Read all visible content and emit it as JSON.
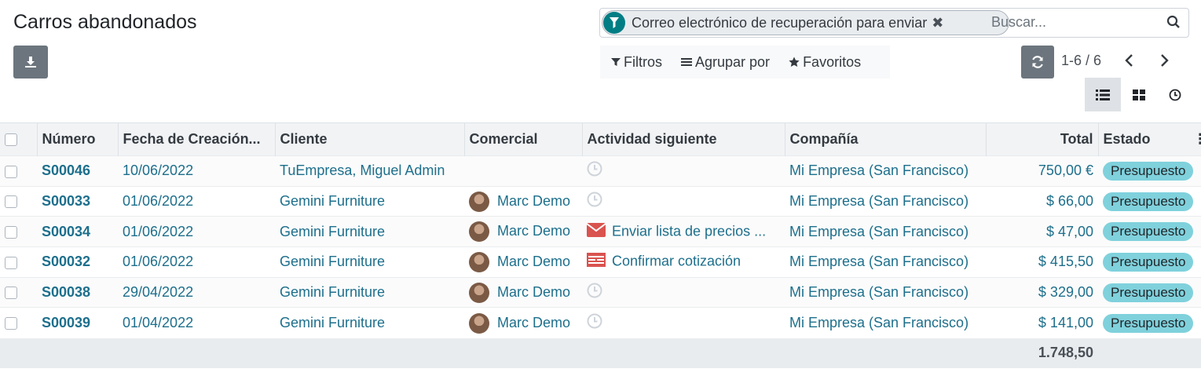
{
  "page": {
    "title": "Carros abandonados"
  },
  "search": {
    "facet_label": "Correo electrónico de recuperación para enviar",
    "facet_close": "✖",
    "placeholder": "Buscar..."
  },
  "filters": {
    "filters_label": "Filtros",
    "group_label": "Agrupar por",
    "favorites_label": "Favoritos"
  },
  "pager": {
    "value": "1-6 / 6"
  },
  "table": {
    "columns": [
      "Número",
      "Fecha de Creación...",
      "Cliente",
      "Comercial",
      "Actividad siguiente",
      "Compañía",
      "Total",
      "Estado"
    ],
    "rows": [
      {
        "number": "S00046",
        "date": "10/06/2022",
        "customer": "TuEmpresa, Miguel Admin",
        "salesperson": "",
        "activity": "",
        "activity_icon": "clock-icon",
        "company": "Mi Empresa (San Francisco)",
        "total": "750,00 €",
        "status": "Presupuesto"
      },
      {
        "number": "S00033",
        "date": "01/06/2022",
        "customer": "Gemini Furniture",
        "salesperson": "Marc Demo",
        "activity": "",
        "activity_icon": "clock-icon",
        "company": "Mi Empresa (San Francisco)",
        "total": "$ 66,00",
        "status": "Presupuesto"
      },
      {
        "number": "S00034",
        "date": "01/06/2022",
        "customer": "Gemini Furniture",
        "salesperson": "Marc Demo",
        "activity": "Enviar lista de precios ...",
        "activity_icon": "envelope-icon",
        "company": "Mi Empresa (San Francisco)",
        "total": "$ 47,00",
        "status": "Presupuesto"
      },
      {
        "number": "S00032",
        "date": "01/06/2022",
        "customer": "Gemini Furniture",
        "salesperson": "Marc Demo",
        "activity": "Confirmar cotización",
        "activity_icon": "document-icon",
        "company": "Mi Empresa (San Francisco)",
        "total": "$ 415,50",
        "status": "Presupuesto"
      },
      {
        "number": "S00038",
        "date": "29/04/2022",
        "customer": "Gemini Furniture",
        "salesperson": "Marc Demo",
        "activity": "",
        "activity_icon": "clock-icon",
        "company": "Mi Empresa (San Francisco)",
        "total": "$ 329,00",
        "status": "Presupuesto"
      },
      {
        "number": "S00039",
        "date": "01/04/2022",
        "customer": "Gemini Furniture",
        "salesperson": "Marc Demo",
        "activity": "",
        "activity_icon": "clock-icon",
        "company": "Mi Empresa (San Francisco)",
        "total": "$ 141,00",
        "status": "Presupuesto"
      }
    ],
    "grand_total": "1.748,50"
  },
  "colors": {
    "accent": "#017e84",
    "link": "#1d6f8c",
    "badge": "#7fd1dc",
    "button_gray": "#6c757d",
    "activity_red": "#d9534f"
  }
}
